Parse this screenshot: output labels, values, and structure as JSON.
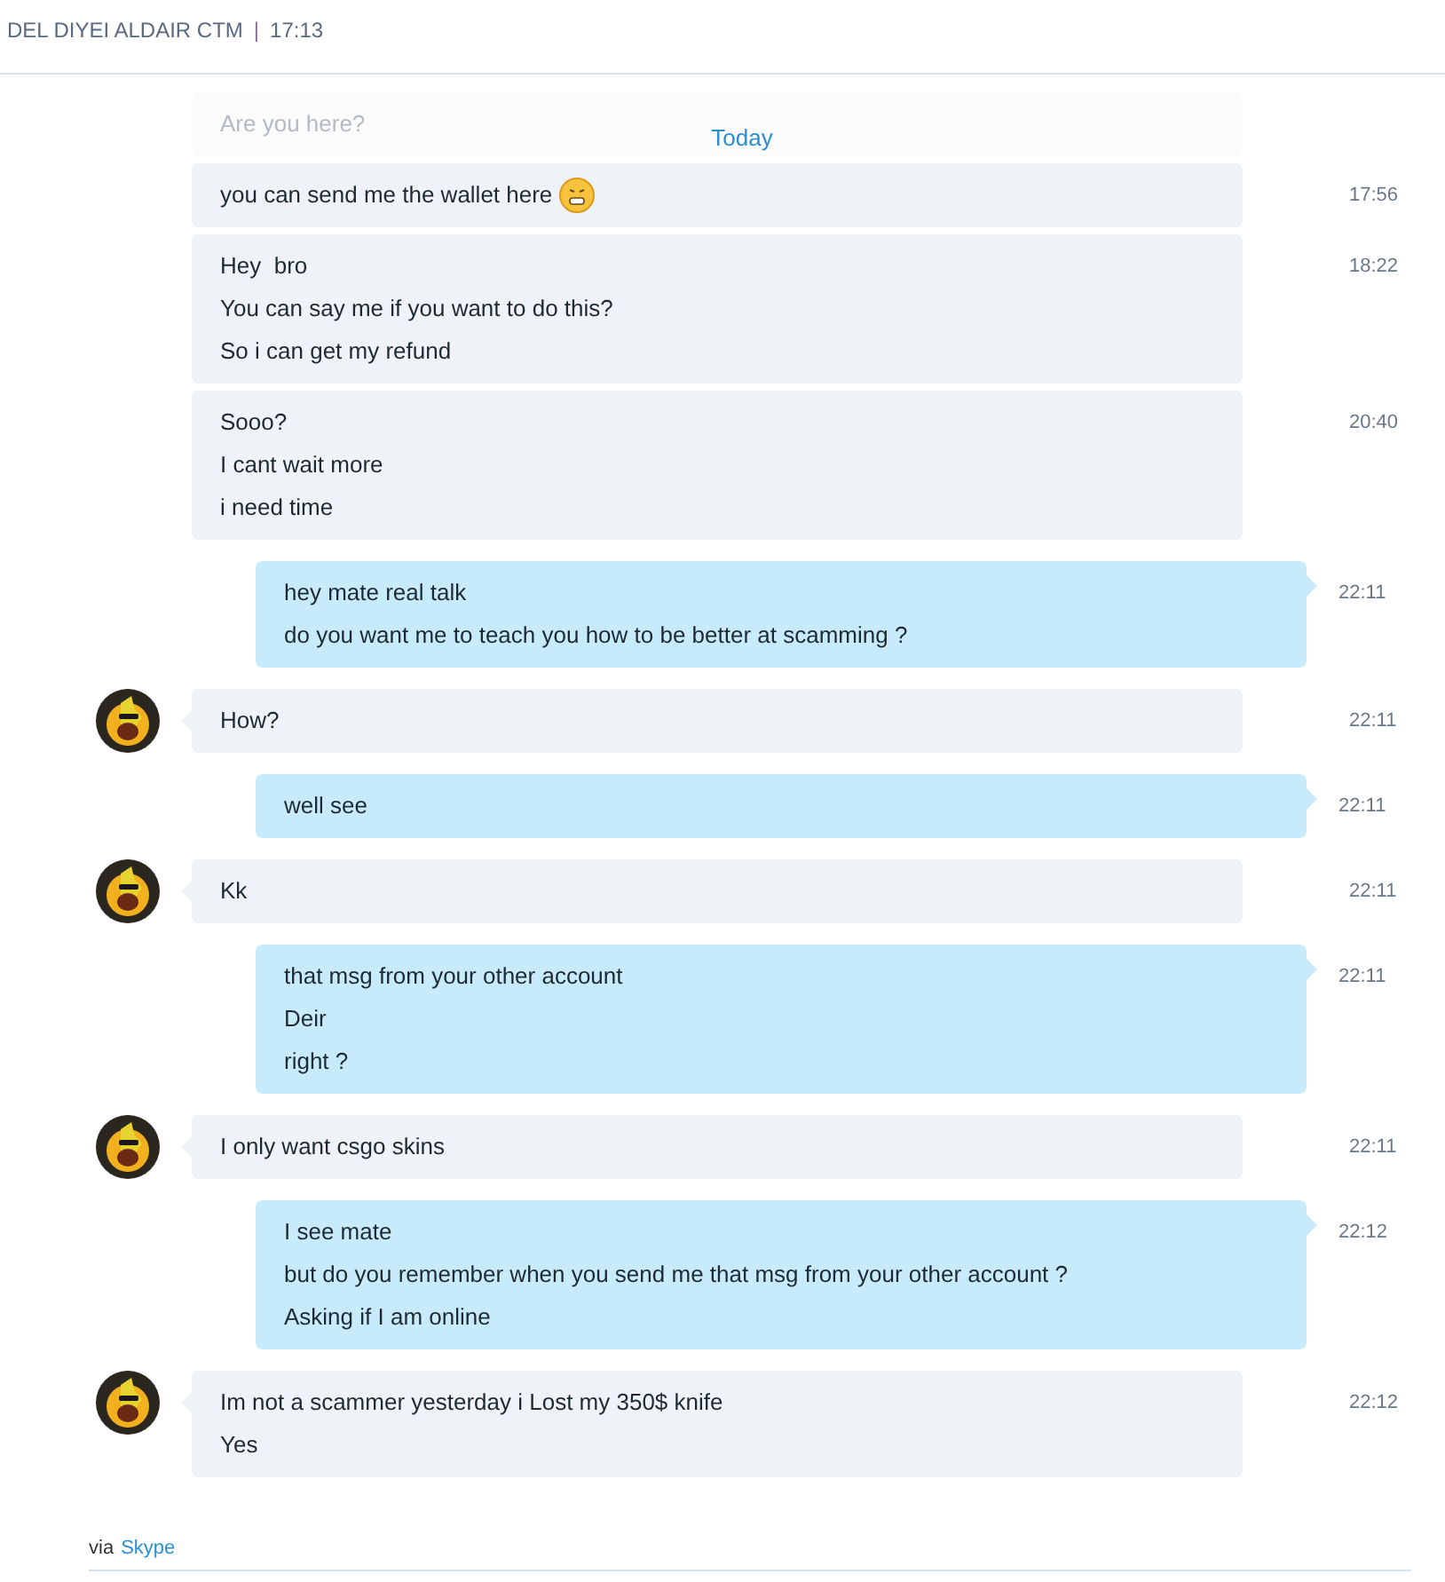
{
  "header": {
    "subtitle": "DEL DIYEI ALDAIR CTM",
    "separator": "|",
    "time": "17:13"
  },
  "day_label": "Today",
  "messages": [
    {
      "kind": "faded",
      "avatar": false,
      "lines": [
        "Are you here?"
      ]
    },
    {
      "kind": "incoming",
      "avatar": false,
      "lines": [
        "you can send me the wallet here"
      ],
      "emoji": true,
      "time": "17:56"
    },
    {
      "kind": "incoming",
      "avatar": false,
      "lines": [
        "Hey  bro",
        "You can say me if you want to do this?",
        "So i can get my refund"
      ],
      "time": "18:22"
    },
    {
      "kind": "incoming",
      "avatar": false,
      "lines": [
        "Sooo?",
        "I cant wait more",
        "i need time"
      ],
      "time": "20:40"
    },
    {
      "kind": "outgoing",
      "avatar": false,
      "lines": [
        "hey mate real talk",
        "do you want me to teach you how to be better at scamming ?"
      ],
      "time": "22:11"
    },
    {
      "kind": "incoming",
      "avatar": true,
      "lines": [
        "How?"
      ],
      "time": "22:11"
    },
    {
      "kind": "outgoing",
      "avatar": false,
      "lines": [
        "well see"
      ],
      "time": "22:11"
    },
    {
      "kind": "incoming",
      "avatar": true,
      "lines": [
        "Kk"
      ],
      "time": "22:11"
    },
    {
      "kind": "outgoing",
      "avatar": false,
      "lines": [
        "that msg from your other account",
        "Deir",
        "right ?"
      ],
      "time": "22:11"
    },
    {
      "kind": "incoming",
      "avatar": true,
      "lines": [
        "I only want csgo skins"
      ],
      "time": "22:11"
    },
    {
      "kind": "outgoing",
      "avatar": false,
      "lines": [
        "I see mate",
        "but do you remember when you send me that msg from your other account ?",
        "Asking if I am online"
      ],
      "time": "22:12"
    },
    {
      "kind": "incoming",
      "avatar": true,
      "lines": [
        "Im not a scammer yesterday i Lost my 350$ knife",
        "Yes"
      ],
      "time": "22:12"
    }
  ],
  "footer": {
    "prefix": "via",
    "link": "Skype"
  }
}
